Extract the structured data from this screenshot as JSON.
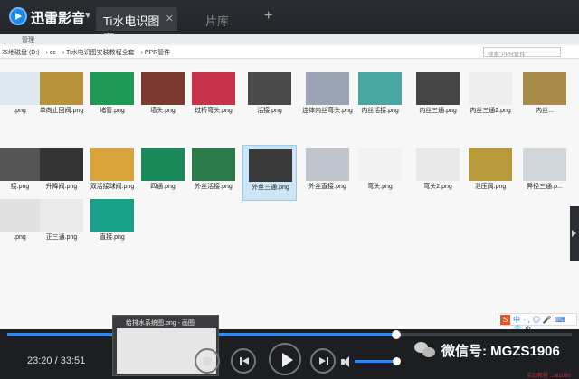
{
  "app": {
    "name": "迅雷影音"
  },
  "tabs": [
    {
      "label": "Ti水电识图安",
      "active": true
    },
    {
      "label": "片库",
      "active": false
    }
  ],
  "video": {
    "ribbon_label": "管理",
    "address_path": [
      "本地磁盘 (D:)",
      "cc",
      "Ti水电识图安装教程全套",
      "PPR管件"
    ],
    "search_placeholder": "搜索\"PPR管件\"",
    "files": [
      {
        "name": ".png",
        "color": "#dfe7ef"
      },
      {
        "name": "单向止回阀.png",
        "color": "#b8923a"
      },
      {
        "name": "堵管.png",
        "color": "#1e9a55"
      },
      {
        "name": "墙头.png",
        "color": "#7a3a2f"
      },
      {
        "name": "过桥弯头.png",
        "color": "#c8324a"
      },
      {
        "name": "活接.png",
        "color": "#4a4a4a"
      },
      {
        "name": "连体内丝弯头.png",
        "color": "#9aa4b4"
      },
      {
        "name": "内丝活接.png",
        "color": "#4aa6a0"
      },
      {
        "name": "内丝三通.png",
        "color": "#444444"
      },
      {
        "name": "内丝三通2.png",
        "color": "#eeeeee"
      },
      {
        "name": "内丝...",
        "color": "#a88a4a"
      },
      {
        "name": "接.png",
        "color": "#555555"
      },
      {
        "name": "升降阀.png",
        "color": "#333333"
      },
      {
        "name": "双活接球阀.png",
        "color": "#d9a43a"
      },
      {
        "name": "四通.png",
        "color": "#1a8a5a"
      },
      {
        "name": "外丝活接.png",
        "color": "#2a7a4a"
      },
      {
        "name": "外丝三通.png",
        "color": "#3a3a3a",
        "selected": true
      },
      {
        "name": "外丝直接.png",
        "color": "#c0c4cc"
      },
      {
        "name": "弯头.png",
        "color": "#f2f2f2"
      },
      {
        "name": "弯头2.png",
        "color": "#e8e8e8"
      },
      {
        "name": "泄压阀.png",
        "color": "#b89a3a"
      },
      {
        "name": "异径三通.p...",
        "color": "#d0d6dc"
      },
      {
        "name": ".png",
        "color": "#e0e0e0"
      },
      {
        "name": "正三通.png",
        "color": "#eaeaea"
      },
      {
        "name": "直接.png",
        "color": "#17a08a"
      }
    ],
    "ime_text": "中·,◎🎤⌨👕⚙"
  },
  "controls": {
    "elapsed": "23:20",
    "total": "33:51",
    "time_display": "23:20 / 33:51",
    "progress_pct": 68.9,
    "volume_pct": 92,
    "preview_title": "给排水系统图.png - 画图"
  },
  "watermark": {
    "text": "微信号: MGZS1906",
    "note": "实战教程 ...ai1080"
  }
}
